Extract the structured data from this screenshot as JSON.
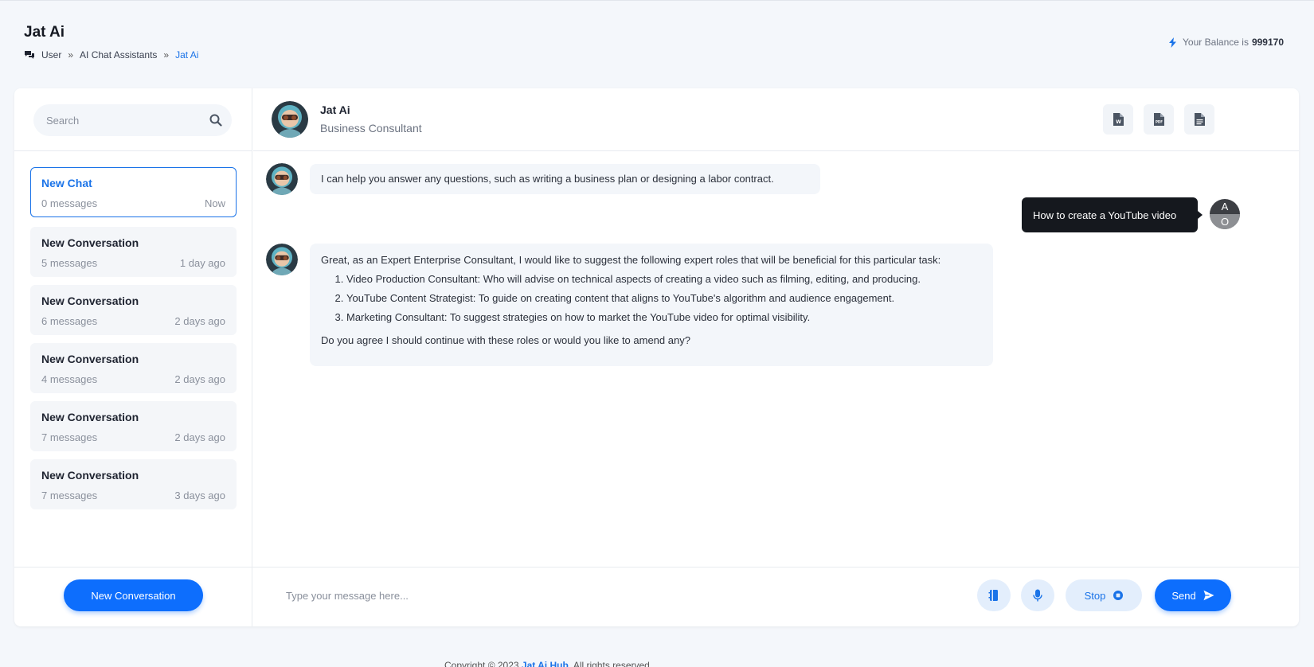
{
  "header": {
    "title": "Jat Ai",
    "breadcrumb": [
      "User",
      "AI Chat Assistants",
      "Jat Ai"
    ],
    "separator": "»",
    "balance_label": "Your Balance is",
    "balance_value": "999170"
  },
  "sidebar": {
    "search_placeholder": "Search",
    "conversations": [
      {
        "title": "New Chat",
        "messages": "0 messages",
        "time": "Now",
        "active": true
      },
      {
        "title": "New Conversation",
        "messages": "5 messages",
        "time": "1 day ago"
      },
      {
        "title": "New Conversation",
        "messages": "6 messages",
        "time": "2 days ago"
      },
      {
        "title": "New Conversation",
        "messages": "4 messages",
        "time": "2 days ago"
      },
      {
        "title": "New Conversation",
        "messages": "7 messages",
        "time": "2 days ago"
      },
      {
        "title": "New Conversation",
        "messages": "7 messages",
        "time": "3 days ago"
      }
    ],
    "new_conversation_label": "New Conversation"
  },
  "chat": {
    "assistant_name": "Jat Ai",
    "assistant_role": "Business Consultant",
    "export_icons": [
      "word-file-icon",
      "pdf-file-icon",
      "text-file-icon"
    ],
    "messages": {
      "greeting": "I can help you answer any questions, such as writing a business plan or designing a labor contract.",
      "user": "How to create a YouTube video",
      "user_avatar_initials": [
        "A",
        "O"
      ],
      "reply_intro": "Great, as an Expert Enterprise Consultant, I would like to suggest the following expert roles that will be beneficial for this particular task:",
      "reply_items": [
        "Video Production Consultant: Who will advise on technical aspects of creating a video such as filming, editing, and producing.",
        "YouTube Content Strategist: To guide on creating content that aligns to YouTube's algorithm and audience engagement.",
        "Marketing Consultant: To suggest strategies on how to market the YouTube video for optimal visibility."
      ],
      "reply_outro": "Do you agree I should continue with these roles or would you like to amend any?"
    },
    "composer": {
      "placeholder": "Type your message here...",
      "stop_label": "Stop",
      "send_label": "Send"
    }
  },
  "footer": {
    "prefix": "Copyright © 2023",
    "brand": "Jat Ai Hub",
    "suffix": ". All rights reserved"
  },
  "colors": {
    "accent": "#0d6efd",
    "user_bubble": "#15181e",
    "page_bg": "#f4f7fb"
  }
}
